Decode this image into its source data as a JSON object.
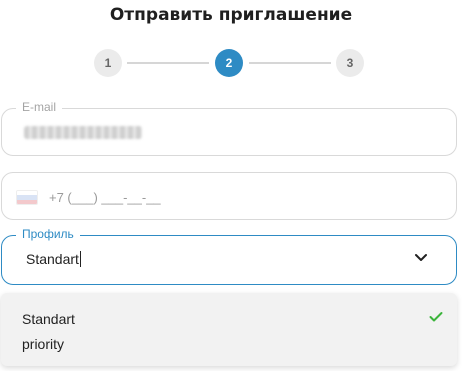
{
  "title": "Отправить приглашение",
  "stepper": {
    "steps": [
      "1",
      "2",
      "3"
    ],
    "active_step": "2"
  },
  "email": {
    "label": "E-mail",
    "value_obscured": true
  },
  "phone": {
    "placeholder": "+7 (___) ___-__-__",
    "flag": "russia-flag-icon"
  },
  "profile": {
    "label": "Профиль",
    "value": "Standart",
    "options": [
      {
        "label": "Standart",
        "selected": true
      },
      {
        "label": "priority",
        "selected": false
      }
    ]
  },
  "colors": {
    "accent": "#2e8bc4",
    "check": "#3cb43c",
    "step_inactive": "#ebebeb"
  }
}
